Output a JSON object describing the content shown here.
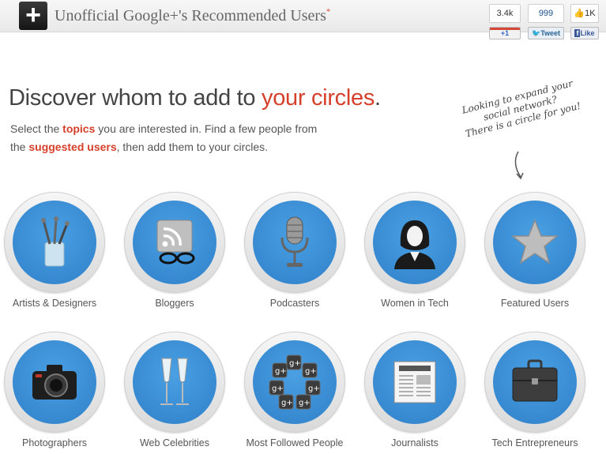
{
  "header": {
    "logo_glyph": "+",
    "title": "Unofficial Google+'s Recommended Users",
    "required_mark": "*"
  },
  "social": {
    "plusone_count": "3.4k",
    "plusone_label": "+1",
    "tweet_count": "999",
    "tweet_label": "Tweet",
    "like_count": "1K",
    "like_label": "Like"
  },
  "hero": {
    "headline_prefix": "Discover whom to add to ",
    "headline_accent": "your circles",
    "headline_suffix": ".",
    "intro_1": "Select the ",
    "intro_topics": "topics",
    "intro_2": " you are interested in. Find a few people from",
    "intro_3": "the ",
    "intro_suggested": "suggested users",
    "intro_4": ", then add them to your circles.",
    "handwritten_1": "Looking to expand your",
    "handwritten_2": "social network?",
    "handwritten_3": "There is a circle for you!"
  },
  "categories": [
    {
      "label": "Artists & Designers",
      "icon": "brushes-icon"
    },
    {
      "label": "Bloggers",
      "icon": "rss-glasses-icon"
    },
    {
      "label": "Podcasters",
      "icon": "microphone-icon"
    },
    {
      "label": "Women in Tech",
      "icon": "woman-icon"
    },
    {
      "label": "Featured Users",
      "icon": "star-icon"
    },
    {
      "label": "Photographers",
      "icon": "camera-icon"
    },
    {
      "label": "Web Celebrities",
      "icon": "champagne-icon"
    },
    {
      "label": "Most Followed People",
      "icon": "google-plus-cluster-icon"
    },
    {
      "label": "Journalists",
      "icon": "newspaper-icon"
    },
    {
      "label": "Tech Entrepreneurs",
      "icon": "briefcase-icon"
    }
  ],
  "colors": {
    "accent": "#d6402b",
    "disc_blue": "#3a8fd8",
    "ring_grey": "#e6e6e6"
  }
}
